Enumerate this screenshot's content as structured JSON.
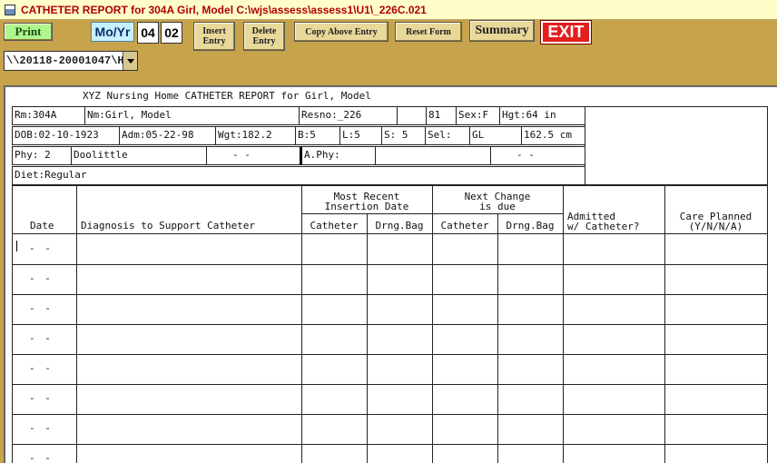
{
  "window": {
    "title": "CATHETER REPORT for 304A  Girl, Model  C:\\wjs\\assess\\assess1\\U1\\_226C.021"
  },
  "toolbar": {
    "print_label": "Print",
    "moyr_label": "Mo/Yr",
    "month": "04",
    "year": "02",
    "insert_label_1": "Insert",
    "insert_label_2": "Entry",
    "delete_label_1": "Delete",
    "delete_label_2": "Entry",
    "copy_label": "Copy Above Entry",
    "reset_label": "Reset Form",
    "summary_label": "Summary",
    "exit_label": "EXIT"
  },
  "path": {
    "value": "\\\\20118-20001047\\H"
  },
  "report": {
    "title": "XYZ Nursing Home CATHETER REPORT for Girl, Model",
    "header": {
      "rm": "Rm:304A",
      "nm": "Nm:Girl, Model",
      "resno": "Resno:_226",
      "blank1": "",
      "age": "81",
      "sex": "Sex:F",
      "hgt": "Hgt:64   in",
      "dob": "DOB:02-10-1923",
      "adm": "Adm:05-22-98",
      "wgt": "Wgt:182.2",
      "b": "B:5",
      "l": "L:5",
      "s": "S: 5",
      "sel": "Sel:",
      "gl": "GL",
      "cm": "162.5 cm",
      "phy": "Phy: 2",
      "phy_name": "Doolittle",
      "phy_date": "-   -",
      "aphy": "A.Phy:",
      "aphy_name": "",
      "aphy_date": "-   -",
      "diet": "Diet:Regular"
    },
    "columns": {
      "date": "Date",
      "diagnosis": "Diagnosis to Support Catheter",
      "most_recent_1": "Most Recent",
      "most_recent_2": "Insertion Date",
      "next_change_1": "Next Change",
      "next_change_2": "is due",
      "catheter": "Catheter",
      "drng_bag": "Drng.Bag",
      "catheter2": "Catheter",
      "drng_bag2": "Drng.Bag",
      "admitted_1": "Admitted",
      "admitted_2": "w/ Catheter?",
      "care_1": "Care Planned",
      "care_2": "(Y/N/N/A)"
    },
    "row_date_placeholder": "-   -"
  }
}
